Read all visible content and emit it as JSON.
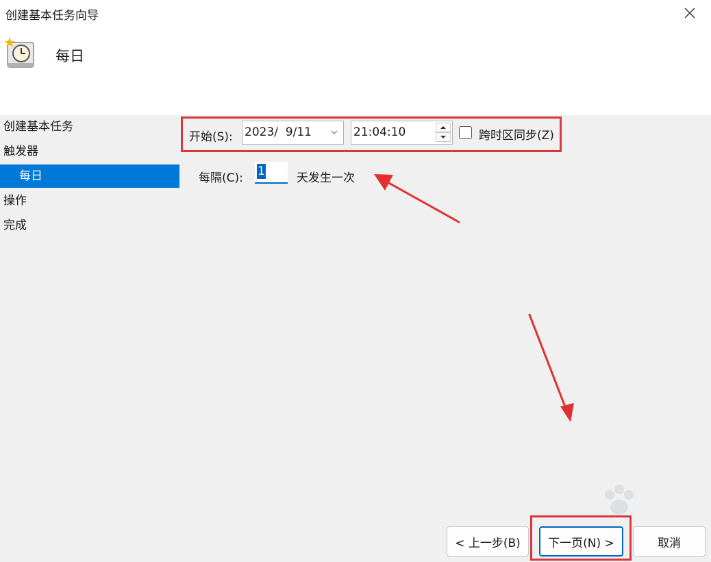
{
  "window": {
    "title": "创建基本任务向导"
  },
  "header": {
    "title": "每日",
    "icon": "scheduled-task-clock-icon"
  },
  "sidebar": {
    "items": [
      {
        "label": "创建基本任务",
        "active": false
      },
      {
        "label": "触发器",
        "active": false
      },
      {
        "label": "每日",
        "active": true
      },
      {
        "label": "操作",
        "active": false
      },
      {
        "label": "完成",
        "active": false
      }
    ]
  },
  "trigger": {
    "start_label": "开始(S):",
    "date_value": "2023/  9/11",
    "time_value": "21:04:10",
    "sync_timezone_label": "跨时区同步(Z)",
    "sync_timezone_checked": false,
    "interval_label": "每隔(C):",
    "interval_value": "1",
    "interval_suffix": "天发生一次"
  },
  "buttons": {
    "back": "< 上一步(B)",
    "next": "下一页(N) >",
    "cancel": "取消"
  },
  "colors": {
    "selection": "#0078d7",
    "annotation": "#d9363e",
    "focus": "#0067c0"
  }
}
